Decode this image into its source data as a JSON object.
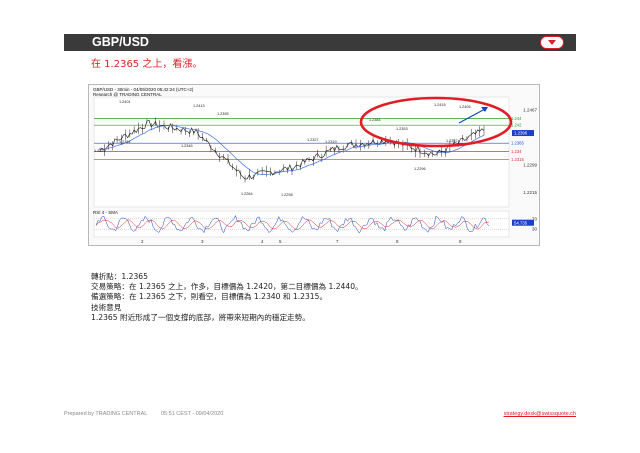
{
  "header": {
    "title": "GBP/USD"
  },
  "headline": "在  1.2365 之上，看漲。",
  "chart": {
    "title": "GBP/USD - 30min - 04/09/2020 05:42:24 (UTC+2)",
    "subtitle": "Research @ TRADING CENTRAL",
    "rsi_label": "RSI 4 - SMA"
  },
  "chart_data": {
    "type": "line",
    "x": [
      "2",
      "3",
      "4",
      "5",
      "7",
      "8",
      "9"
    ],
    "series": [
      {
        "values": [
          1.2345,
          1.2425,
          1.24,
          1.226,
          1.229,
          1.2355,
          1.2375,
          1.233,
          1.2405
        ]
      }
    ],
    "ylim": [
      1.217,
      1.25
    ],
    "y_ticks": [
      "1.2467",
      "1.2299",
      "1.2215"
    ],
    "resistance_levels": [
      "1.244",
      "1.242"
    ],
    "pivot_level": "1.2365",
    "support_levels": [
      "1.234",
      "1.2315"
    ],
    "current_price": "1.2396",
    "annotations": [
      "1.2401",
      "1.2413",
      "1.2395",
      "1.2384",
      "1.2353",
      "1.2415",
      "1.2405",
      "1.2329",
      "1.2351",
      "1.2346",
      "1.2264",
      "1.2298",
      "1.2327",
      "1.2319",
      "1.2296",
      "1.2357"
    ],
    "rsi": {
      "label": "RSI 4 - SMA",
      "ticks": [
        "70",
        "30"
      ],
      "current": "54.735"
    }
  },
  "info": {
    "pivot": "轉折點：1.2365",
    "trading": "交易策略：在 1.2365 之上，作多，目標價為 1.2420，第二目標價為 1.2440。",
    "alternative": "備選策略：在 1.2365 之下，則看空，目標價為 1.2340 和 1.2315。",
    "comment_title": "技術意見",
    "comment": "1.2365 附近形成了一個支撐的底部，將帶來短期內的穩定走勢。"
  },
  "footer": {
    "prepared": "Prepared by TRADING CENTRAL",
    "time": "05:51 CEST - 09/04/2020",
    "link": "strategy.desk@swissquote.ch"
  },
  "colors": {
    "accent": "#e01c24",
    "header_bg": "#3a3a3a",
    "resistance": "#2e9d2e",
    "pivot": "#2247d6",
    "support": "#e0303a"
  }
}
